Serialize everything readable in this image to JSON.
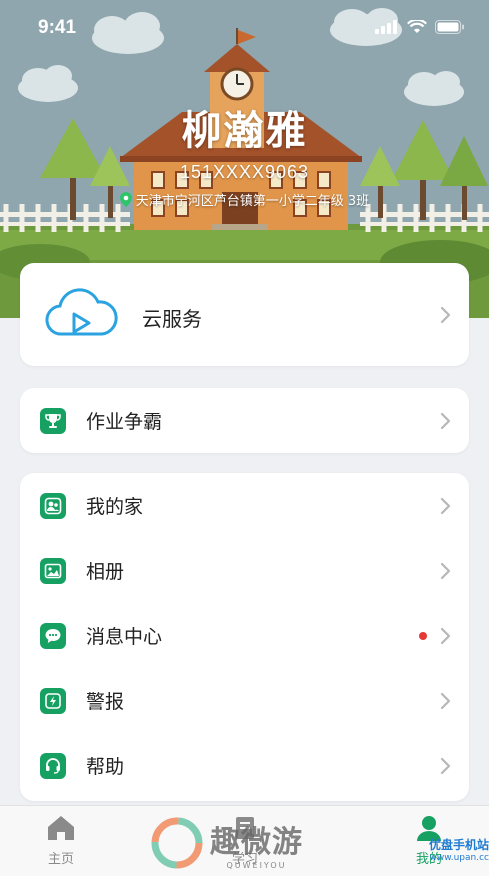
{
  "status": {
    "time": "9:41"
  },
  "profile": {
    "name": "柳瀚雅",
    "phone": "151XXXX9063",
    "school": "天津市宁河区芦台镇第一小学二年级 3班"
  },
  "cloud": {
    "label": "云服务",
    "icon": "cloud-play-icon"
  },
  "homework": {
    "label": "作业争霸",
    "icon": "trophy-icon"
  },
  "menu": [
    {
      "label": "我的家",
      "icon": "family-icon"
    },
    {
      "label": "相册",
      "icon": "photo-icon"
    },
    {
      "label": "消息中心",
      "icon": "message-icon",
      "unread": true
    },
    {
      "label": "警报",
      "icon": "alarm-icon"
    },
    {
      "label": "帮助",
      "icon": "headset-icon"
    }
  ],
  "tabs": [
    {
      "label": "主页",
      "icon": "home-icon"
    },
    {
      "label": "学习",
      "icon": "study-icon"
    },
    {
      "label": "我的",
      "icon": "profile-icon",
      "active": true
    }
  ],
  "watermarks": {
    "left_brand": "趣微游",
    "left_sub": "QUWEIYOU",
    "right_brand": "优盘手机站",
    "right_sub": "www.upan.cc"
  },
  "colors": {
    "accent": "#16a163",
    "unread_dot": "#e53935",
    "hero_sky": "#8fa6ae"
  }
}
